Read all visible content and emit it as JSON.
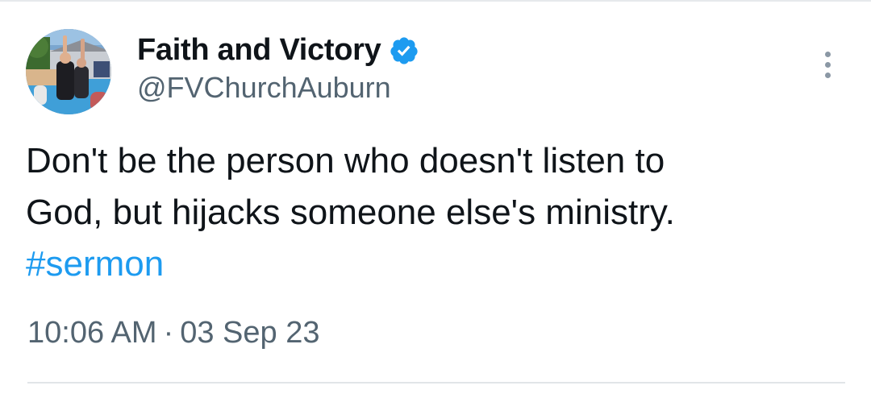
{
  "author": {
    "display_name": "Faith and Victory",
    "handle": "@FVChurchAuburn",
    "verified": true,
    "badge_color": "#1d9bf0"
  },
  "tweet": {
    "text_lines": [
      "Don't be the person who doesn't listen to",
      "God, but hijacks someone else's ministry."
    ],
    "hashtag": "#sermon",
    "time": "10:06 AM",
    "separator": "·",
    "date": "03 Sep 23"
  },
  "icons": {
    "more": "more-vertical-icon",
    "verified": "verified-badge-icon",
    "avatar": "avatar-photo"
  },
  "colors": {
    "text": "#0f1419",
    "secondary": "#536471",
    "link": "#1d9bf0",
    "divider": "#e1e5e8"
  }
}
